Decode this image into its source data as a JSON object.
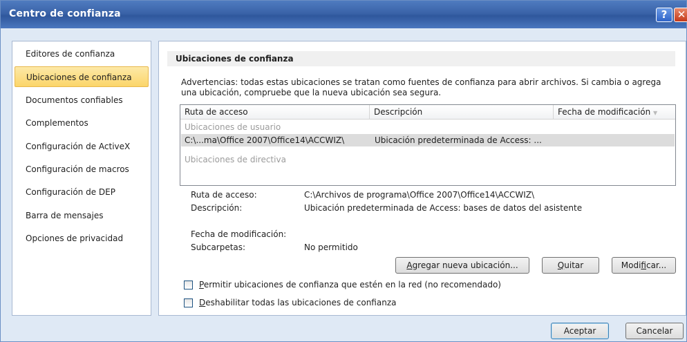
{
  "window": {
    "title": "Centro de confianza",
    "help_glyph": "?",
    "close_glyph": "✕"
  },
  "sidebar": {
    "items": [
      {
        "label": "Editores de confianza"
      },
      {
        "label": "Ubicaciones de confianza",
        "selected": true
      },
      {
        "label": "Documentos confiables"
      },
      {
        "label": "Complementos"
      },
      {
        "label": "Configuración de ActiveX"
      },
      {
        "label": "Configuración de macros"
      },
      {
        "label": "Configuración de DEP"
      },
      {
        "label": "Barra de mensajes"
      },
      {
        "label": "Opciones de privacidad"
      }
    ]
  },
  "main": {
    "section_title": "Ubicaciones de confianza",
    "warning": "Advertencias: todas estas ubicaciones se tratan como fuentes de confianza para abrir archivos. Si cambia o agrega una ubicación, compruebe que la nueva ubicación sea segura.",
    "list": {
      "columns": [
        "Ruta de acceso",
        "Descripción",
        "Fecha de modificación"
      ],
      "sort_glyph": "▼",
      "group_user": "Ubicaciones de usuario",
      "rows": [
        {
          "path": "C:\\...ma\\Office 2007\\Office14\\ACCWIZ\\",
          "description": "Ubicación predeterminada de Access: ...",
          "date": ""
        }
      ],
      "group_policy": "Ubicaciones de directiva"
    },
    "details": {
      "path_label": "Ruta de acceso:",
      "path_value": "C:\\Archivos de programa\\Office 2007\\Office14\\ACCWIZ\\",
      "desc_label": "Descripción:",
      "desc_value": "Ubicación predeterminada de Access: bases de datos del asistente",
      "date_label": "Fecha de modificación:",
      "date_value": "",
      "subfolders_label": "Subcarpetas:",
      "subfolders_value": "No permitido"
    },
    "buttons": {
      "add_accel": "A",
      "add_rest": "gregar nueva ubicación...",
      "remove_accel": "Q",
      "remove_rest": "uitar",
      "modify_pre": "Modi",
      "modify_accel": "f",
      "modify_rest": "icar..."
    },
    "options": {
      "network_accel": "P",
      "network_rest": "ermitir ubicaciones de confianza que estén en la red (no recomendado)",
      "network_checked": false,
      "disable_accel": "D",
      "disable_rest": "eshabilitar todas las ubicaciones de confianza",
      "disable_checked": false
    }
  },
  "footer": {
    "ok": "Aceptar",
    "cancel": "Cancelar"
  }
}
